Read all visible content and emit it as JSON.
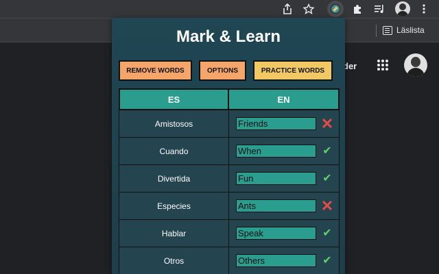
{
  "bookmarks": {
    "reading_list": "Läslista"
  },
  "page": {
    "partial_text": "der"
  },
  "popup": {
    "title": "Mark & Learn",
    "buttons": {
      "remove": "REMOVE WORDS",
      "options": "OPTIONS",
      "practice": "PRACTICE WORDS"
    },
    "table": {
      "headers": [
        "ES",
        "EN"
      ],
      "rows": [
        {
          "es": "Amistosos",
          "en": "Friends",
          "correct": false
        },
        {
          "es": "Cuando",
          "en": "When",
          "correct": true
        },
        {
          "es": "Divertida",
          "en": "Fun",
          "correct": true
        },
        {
          "es": "Especies",
          "en": "Ants",
          "correct": false
        },
        {
          "es": "Hablar",
          "en": "Speak",
          "correct": true
        },
        {
          "es": "Otros",
          "en": "Others",
          "correct": true
        }
      ]
    }
  },
  "icons": {
    "share": "share-icon",
    "star": "star-icon",
    "extension_active": "mark-learn-extension-icon",
    "puzzle": "extensions-puzzle-icon",
    "media": "media-queue-icon",
    "menu": "kebab-menu-icon",
    "check": "check-icon",
    "cross": "cross-icon"
  },
  "colors": {
    "popup_bg": "#204653",
    "header_teal": "#2a9d8f",
    "button_orange": "#f4a56a",
    "button_yellow": "#f1c863",
    "check_green": "#5fd06b",
    "cross_red": "#e34d45"
  }
}
